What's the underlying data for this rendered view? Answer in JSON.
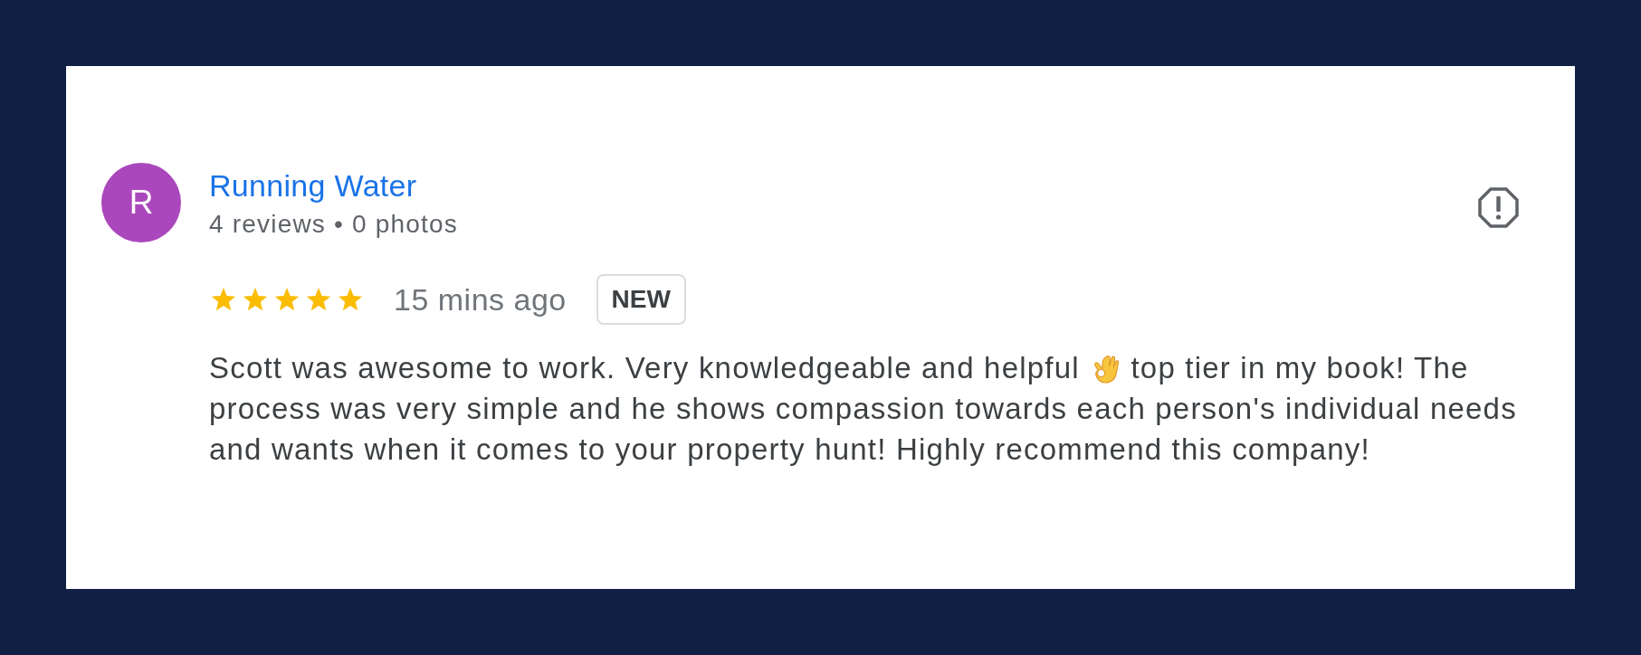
{
  "reviewer": {
    "avatar_letter": "R",
    "name": "Running Water",
    "stats": "4 reviews • 0 photos"
  },
  "review": {
    "stars": 5,
    "time": "15 mins ago",
    "badge": "NEW",
    "body": [
      {
        "kind": "text",
        "text": "Scott was awesome to work. Very knowledgeable and helpful"
      },
      {
        "kind": "emoji"
      },
      {
        "kind": "text",
        "text": "top tier in my book! The process was very simple and he shows compassion towards each person's individual needs and wants when it comes to your property hunt! Highly recommend this company!"
      }
    ]
  }
}
